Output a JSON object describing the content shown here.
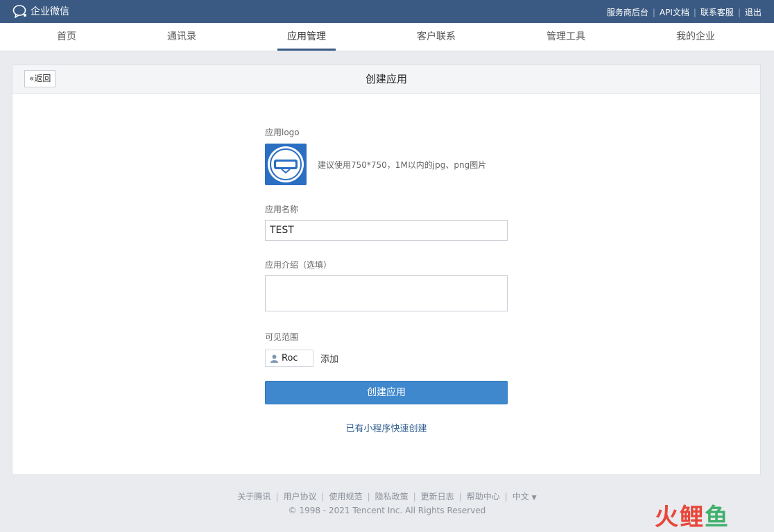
{
  "topbar": {
    "brand": "企业微信",
    "links": [
      "服务商后台",
      "API文档",
      "联系客服",
      "退出"
    ]
  },
  "nav": {
    "items": [
      "首页",
      "通讯录",
      "应用管理",
      "客户联系",
      "管理工具",
      "我的企业"
    ],
    "active": "应用管理"
  },
  "panel": {
    "back_label": "返回",
    "title": "创建应用"
  },
  "form": {
    "logo_label": "应用logo",
    "logo_hint": "建议使用750*750，1M以内的jpg、png图片",
    "name_label": "应用名称",
    "name_value": "TEST",
    "intro_label": "应用介绍（选填）",
    "intro_value": "",
    "scope_label": "可见范围",
    "member": "Roc",
    "add_label": "添加",
    "create_button": "创建应用",
    "mini_program_link": "已有小程序快速创建"
  },
  "footer": {
    "links": [
      "关于腾讯",
      "用户协议",
      "使用规范",
      "隐私政策",
      "更新日志",
      "帮助中心"
    ],
    "language": "中文",
    "copyright": "© 1998 - 2021 Tencent Inc. All Rights Reserved"
  },
  "watermark": "火鲤鱼",
  "colors": {
    "topbar": "#3a5a83",
    "primary_button": "#3f88cd",
    "logo_bg": "#2a6fc2"
  }
}
